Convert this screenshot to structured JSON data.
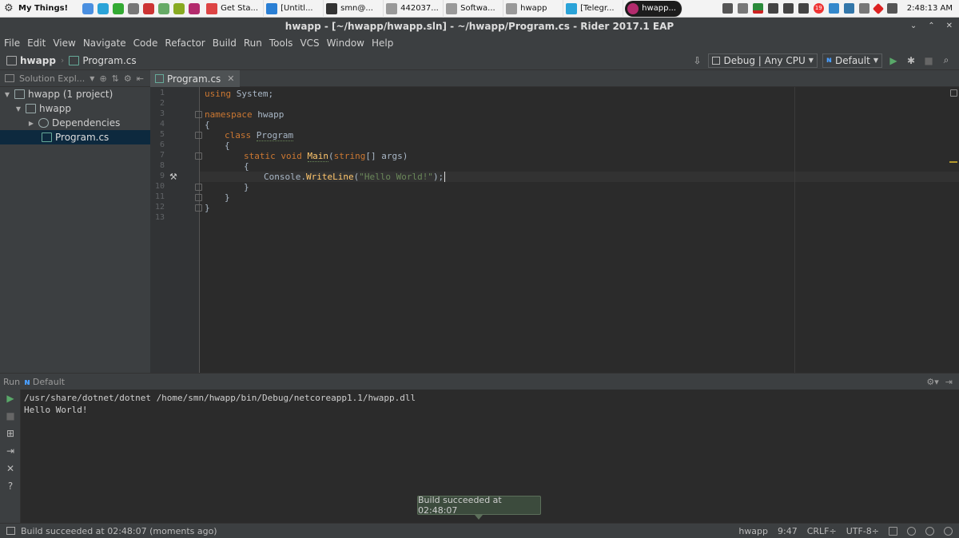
{
  "system_bar": {
    "menu_label": "My Things!",
    "tasks": [
      {
        "label": "Get Sta...",
        "color": "#d44"
      },
      {
        "label": "[Untitl...",
        "color": "#2a7fd4"
      },
      {
        "label": "smn@...",
        "color": "#333"
      },
      {
        "label": "442037...",
        "color": "#999"
      },
      {
        "label": "Softwa...",
        "color": "#999"
      },
      {
        "label": "hwapp",
        "color": "#999"
      },
      {
        "label": "[Telegr...",
        "color": "#2aa3d8"
      },
      {
        "label": "hwapp...",
        "color": "#b32b6d"
      }
    ],
    "clock": "2:48:13 AM",
    "notification_count": "19"
  },
  "window": {
    "title": "hwapp - [~/hwapp/hwapp.sln] - ~/hwapp/Program.cs - Rider 2017.1 EAP"
  },
  "menu": [
    "File",
    "Edit",
    "View",
    "Navigate",
    "Code",
    "Refactor",
    "Build",
    "Run",
    "Tools",
    "VCS",
    "Window",
    "Help"
  ],
  "navbar": {
    "crumb_project": "hwapp",
    "crumb_file": "Program.cs",
    "config_combo": "Debug | Any CPU",
    "run_config_combo": "Default"
  },
  "sidebar": {
    "header": "Solution Expl...",
    "tree": [
      {
        "label": "hwapp (1 project)",
        "indent": 0,
        "arrow": "▼"
      },
      {
        "label": "hwapp",
        "indent": 1,
        "arrow": "▼"
      },
      {
        "label": "Dependencies",
        "indent": 2,
        "arrow": "▶"
      },
      {
        "label": "Program.cs",
        "indent": 3,
        "arrow": ""
      }
    ]
  },
  "editor": {
    "tab": "Program.cs",
    "line_numbers": [
      "1",
      "2",
      "3",
      "4",
      "5",
      "6",
      "7",
      "8",
      "9",
      "10",
      "11",
      "12",
      "13"
    ]
  },
  "code": {
    "l1_kw": "using",
    "l1_rest": " System;",
    "l3_kw": "namespace",
    "l3_rest": " hwapp",
    "l4": "{",
    "l5_kw": "class",
    "l5_name": "Program",
    "l6": "{",
    "l7_kw1": "static",
    "l7_kw2": "void",
    "l7_name": "Main",
    "l7_paren": "(",
    "l7_type": "string",
    "l7_rest": "[] args)",
    "l8": "{",
    "l9_a": "Console.",
    "l9_m": "WriteLine",
    "l9_b": "(",
    "l9_s": "\"Hello World!\"",
    "l9_c": ");",
    "l10": "}",
    "l11": "}",
    "l12": "}"
  },
  "run_panel": {
    "label": "Run",
    "config": "Default",
    "console_lines": [
      "/usr/share/dotnet/dotnet /home/smn/hwapp/bin/Debug/netcoreapp1.1/hwapp.dll",
      "Hello World!"
    ]
  },
  "toast": "Build succeeded at 02:48:07",
  "status": {
    "message": "Build succeeded at 02:48:07 (moments ago)",
    "project": "hwapp",
    "position": "9:47",
    "line_sep": "CRLF÷",
    "encoding": "UTF-8÷"
  }
}
